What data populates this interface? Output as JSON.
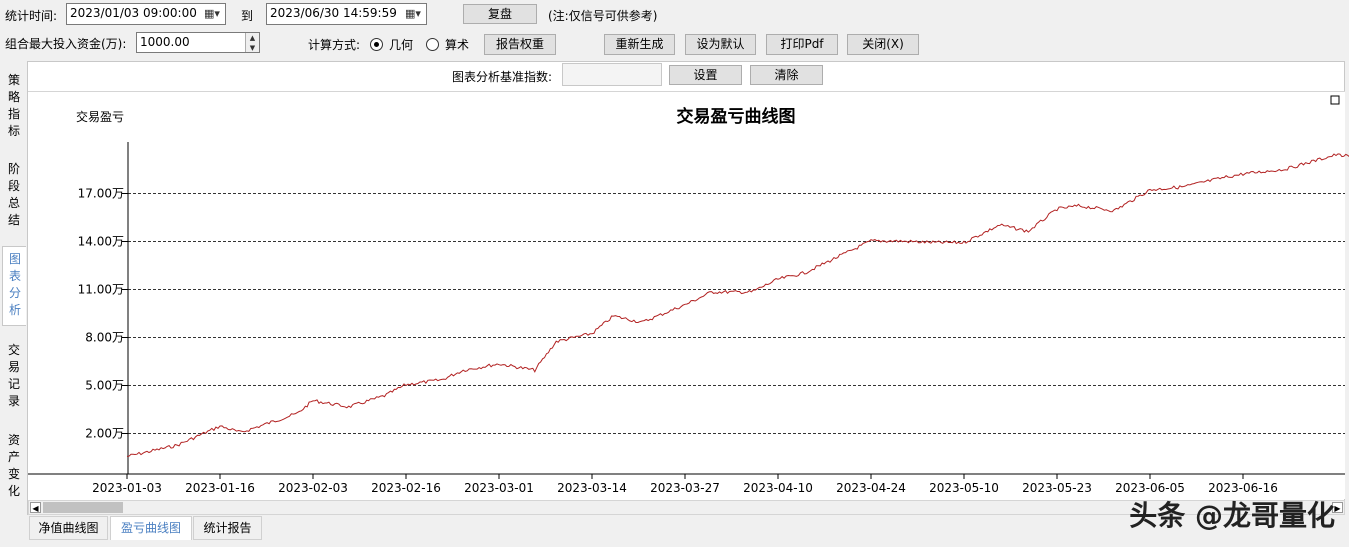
{
  "toolbar": {
    "time_label": "统计时间:",
    "start_time": "2023/01/03 09:00:00",
    "to_label": "到",
    "end_time": "2023/06/30 14:59:59",
    "replay_button": "复盘",
    "note": "(注:仅信号可供参考)",
    "capital_label": "组合最大投入资金(万):",
    "capital_value": "1000.00",
    "calc_method_label": "计算方式:",
    "radio_geometric": "几何",
    "radio_arithmetic": "算术",
    "report_weight_button": "报告权重",
    "regenerate_button": "重新生成",
    "set_default_button": "设为默认",
    "print_pdf_button": "打印Pdf",
    "close_button": "关闭(X)"
  },
  "benchmark": {
    "label": "图表分析基准指数:",
    "value": "",
    "set_button": "设置",
    "clear_button": "清除"
  },
  "side_tabs": [
    {
      "label": "策略指标",
      "active": false
    },
    {
      "label": "阶段总结",
      "active": false
    },
    {
      "label": "图表分析",
      "active": true
    },
    {
      "label": "交易记录",
      "active": false
    },
    {
      "label": "资产变化",
      "active": false
    }
  ],
  "bottom_tabs": [
    {
      "label": "净值曲线图",
      "active": false
    },
    {
      "label": "盈亏曲线图",
      "active": true
    },
    {
      "label": "统计报告",
      "active": false
    }
  ],
  "watermark": "头条 @龙哥量化",
  "chart_data": {
    "type": "line",
    "title": "交易盈亏曲线图",
    "ylabel": "交易盈亏",
    "y_ticks": [
      "2.00万",
      "5.00万",
      "8.00万",
      "11.00万",
      "14.00万",
      "17.00万"
    ],
    "y_tick_values": [
      2,
      5,
      8,
      11,
      14,
      17
    ],
    "ylim": [
      -0.6,
      20.2
    ],
    "x_ticks": [
      "2023-01-03",
      "2023-01-16",
      "2023-02-03",
      "2023-02-16",
      "2023-03-01",
      "2023-03-14",
      "2023-03-27",
      "2023-04-10",
      "2023-04-24",
      "2023-05-10",
      "2023-05-23",
      "2023-06-05",
      "2023-06-16"
    ],
    "grid": true,
    "line_color": "#b22222",
    "series": [
      {
        "x": [
          "2023-01-03",
          "2023-01-10",
          "2023-01-16",
          "2023-01-20",
          "2023-01-31",
          "2023-02-03",
          "2023-02-08",
          "2023-02-13",
          "2023-02-16",
          "2023-02-21",
          "2023-02-24",
          "2023-03-01",
          "2023-03-06",
          "2023-03-09",
          "2023-03-14",
          "2023-03-17",
          "2023-03-21",
          "2023-03-27",
          "2023-03-31",
          "2023-04-06",
          "2023-04-10",
          "2023-04-14",
          "2023-04-19",
          "2023-04-24",
          "2023-04-28",
          "2023-05-05",
          "2023-05-10",
          "2023-05-15",
          "2023-05-19",
          "2023-05-23",
          "2023-05-26",
          "2023-05-31",
          "2023-06-05",
          "2023-06-09",
          "2023-06-14",
          "2023-06-16",
          "2023-06-21",
          "2023-06-27",
          "2023-06-30"
        ],
        "values": [
          0.5,
          1.2,
          2.4,
          2.0,
          3.2,
          4.0,
          3.6,
          4.3,
          5.0,
          5.3,
          5.9,
          6.3,
          5.9,
          7.7,
          8.2,
          9.3,
          8.9,
          10.0,
          10.8,
          10.8,
          11.6,
          12.0,
          13.0,
          14.0,
          14.0,
          13.9,
          13.9,
          15.0,
          14.6,
          16.0,
          16.2,
          15.9,
          17.2,
          17.4,
          18.0,
          18.2,
          18.5,
          19.4,
          19.2
        ]
      }
    ]
  }
}
